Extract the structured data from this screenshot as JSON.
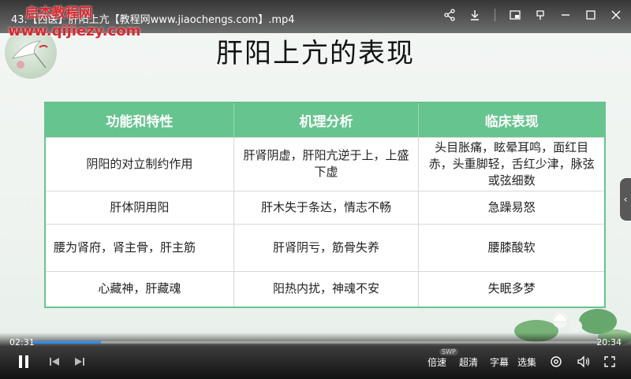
{
  "window": {
    "title": "43.【西医】肝阳上亢【教程网www.jiaochengs.com】.mp4"
  },
  "watermark": {
    "line1": "启杰教程网",
    "line2": "www.qijiezy.com"
  },
  "slide": {
    "heading": "肝阳上亢的表现",
    "table": {
      "headers": [
        "功能和特性",
        "机理分析",
        "临床表现"
      ],
      "rows": [
        [
          "阴阳的对立制约作用",
          "肝肾阴虚，肝阳亢逆于上，上盛下虚",
          "头目胀痛，眩晕耳鸣，面红目赤，头重脚轻，舌红少津，脉弦或弦细数"
        ],
        [
          "肝体阴用阳",
          "肝木失于条达，情志不畅",
          "急躁易怒"
        ],
        [
          "腰为肾府，肾主骨，肝主筋",
          "肝肾阴亏，筋骨失养",
          "腰膝酸软"
        ],
        [
          "心藏神，肝藏魂",
          "阳热内扰，神魂不安",
          "失眠多梦"
        ]
      ]
    }
  },
  "player": {
    "current_time": "02:31",
    "total_time": "20:34",
    "progress_fraction": 0.12,
    "speed_label": "倍速",
    "speed_badge": "SWP",
    "quality_label": "超清",
    "subtitle_label": "字幕",
    "episodes_label": "选集",
    "accent_color": "#2d8cf0"
  },
  "colors": {
    "table_header": "#66c48e"
  }
}
